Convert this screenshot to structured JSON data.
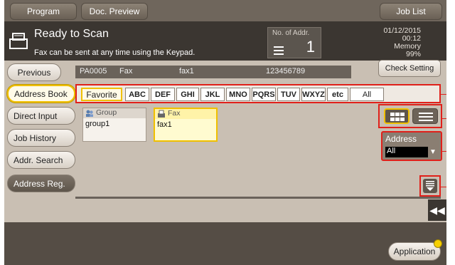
{
  "top_buttons": {
    "program": "Program",
    "doc_preview": "Doc. Preview",
    "job_list": "Job List"
  },
  "header": {
    "title": "Ready to Scan",
    "subtitle": "Fax can be sent at any time using the Keypad.",
    "addr_label": "No. of Addr.",
    "addr_count": "1",
    "date": "01/12/2015",
    "time": "00:12",
    "memory_label": "Memory",
    "memory_value": "99%"
  },
  "left_nav": {
    "previous": "Previous",
    "address_book": "Address Book",
    "direct_input": "Direct Input",
    "job_history": "Job History",
    "addr_search": "Addr. Search",
    "address_reg": "Address Reg."
  },
  "info_bar": {
    "id": "PA0005",
    "type": "Fax",
    "name": "fax1",
    "number": "123456789"
  },
  "check_setting": "Check Setting",
  "tabs": [
    "Favorite",
    "ABC",
    "DEF",
    "GHI",
    "JKL",
    "MNO",
    "PQRS",
    "TUV",
    "WXYZ",
    "etc",
    "All"
  ],
  "entries": [
    {
      "type": "Group",
      "name": "group1",
      "icon": "group-icon",
      "selected": false
    },
    {
      "type": "Fax",
      "name": "fax1",
      "icon": "fax-icon",
      "selected": true
    }
  ],
  "address_select": {
    "label": "Address",
    "value": "All"
  },
  "application": "Application",
  "colors": {
    "highlight": "#f0c000",
    "callout": "#e0201a"
  }
}
